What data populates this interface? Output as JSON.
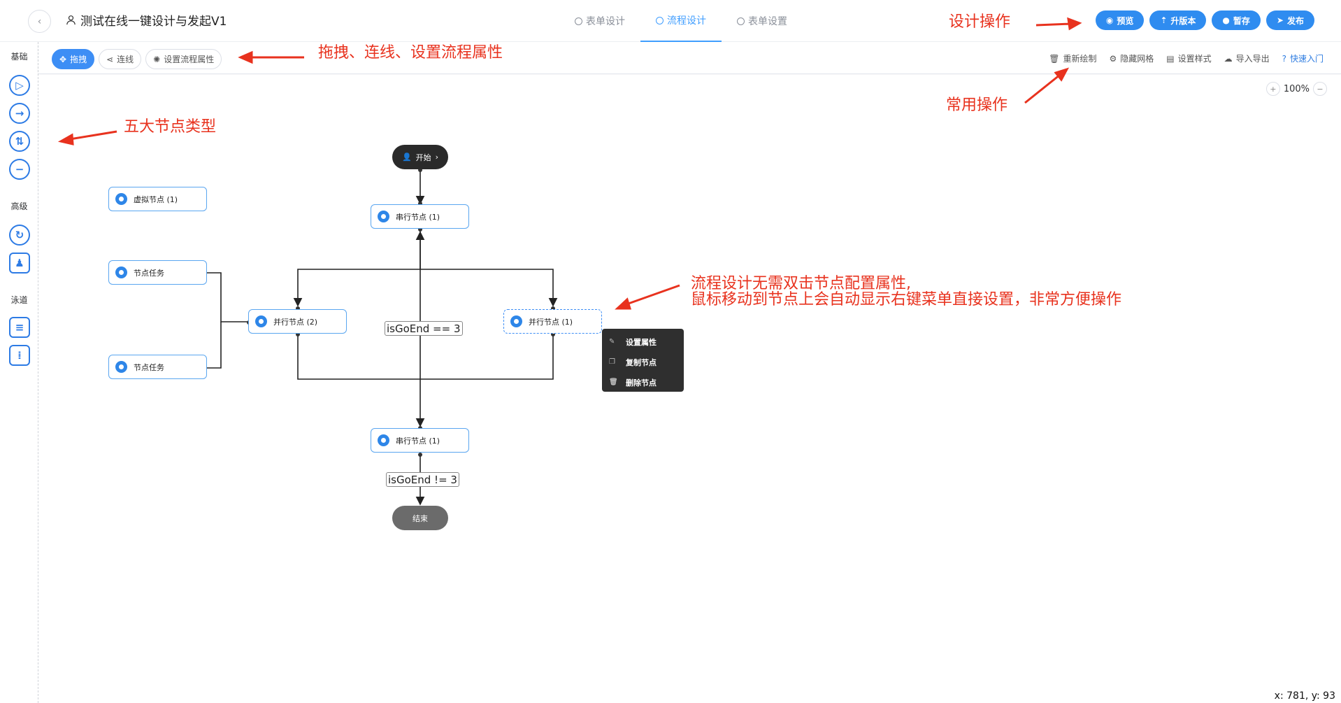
{
  "header": {
    "back_icon": "chevron-left-icon",
    "title": "测试在线一键设计与发起V1",
    "tabs": [
      {
        "label": "表单设计",
        "active": false
      },
      {
        "label": "流程设计",
        "active": true
      },
      {
        "label": "表单设置",
        "active": false
      }
    ],
    "actions": [
      {
        "label": "预览",
        "icon": "eye-icon"
      },
      {
        "label": "升版本",
        "icon": "upload-icon"
      },
      {
        "label": "暂存",
        "icon": "save-icon"
      },
      {
        "label": "发布",
        "icon": "send-icon"
      }
    ]
  },
  "toolbar": {
    "modes": [
      {
        "label": "拖拽",
        "active": true
      },
      {
        "label": "连线",
        "active": false
      },
      {
        "label": "设置流程属性",
        "active": false
      }
    ],
    "ops": [
      {
        "label": "重新绘制"
      },
      {
        "label": "隐藏网格"
      },
      {
        "label": "设置样式"
      },
      {
        "label": "导入导出"
      },
      {
        "label": "快速入门"
      }
    ]
  },
  "sidebar": {
    "groups": [
      "基础",
      "高级",
      "泳道"
    ]
  },
  "canvas": {
    "zoom": "100%",
    "start": "开始",
    "end": "结束",
    "nodes": {
      "virtual": "虚拟节点 (1)",
      "task1": "节点任务",
      "task2": "节点任务",
      "serial1": "串行节点 (1)",
      "parallel2": "并行节点 (2)",
      "parallel1": "并行节点 (1)",
      "serial2": "串行节点 (1)"
    },
    "conditions": {
      "mid": "isGoEnd == 3",
      "bottom": "isGoEnd != 3"
    },
    "context_menu": [
      "设置属性",
      "复制节点",
      "删除节点"
    ],
    "coords": "x: 781, y: 93"
  },
  "annotations": {
    "design_ops": "设计操作",
    "modes": "拖拽、连线、设置流程属性",
    "common_ops": "常用操作",
    "node_types": "五大节点类型",
    "tip_line1": "流程设计无需双击节点配置属性,",
    "tip_line2": "鼠标移动到节点上会自动显示右键菜单直接设置，非常方便操作"
  },
  "colors": {
    "primary": "#2f8cf0",
    "annotation": "#e8321e"
  }
}
